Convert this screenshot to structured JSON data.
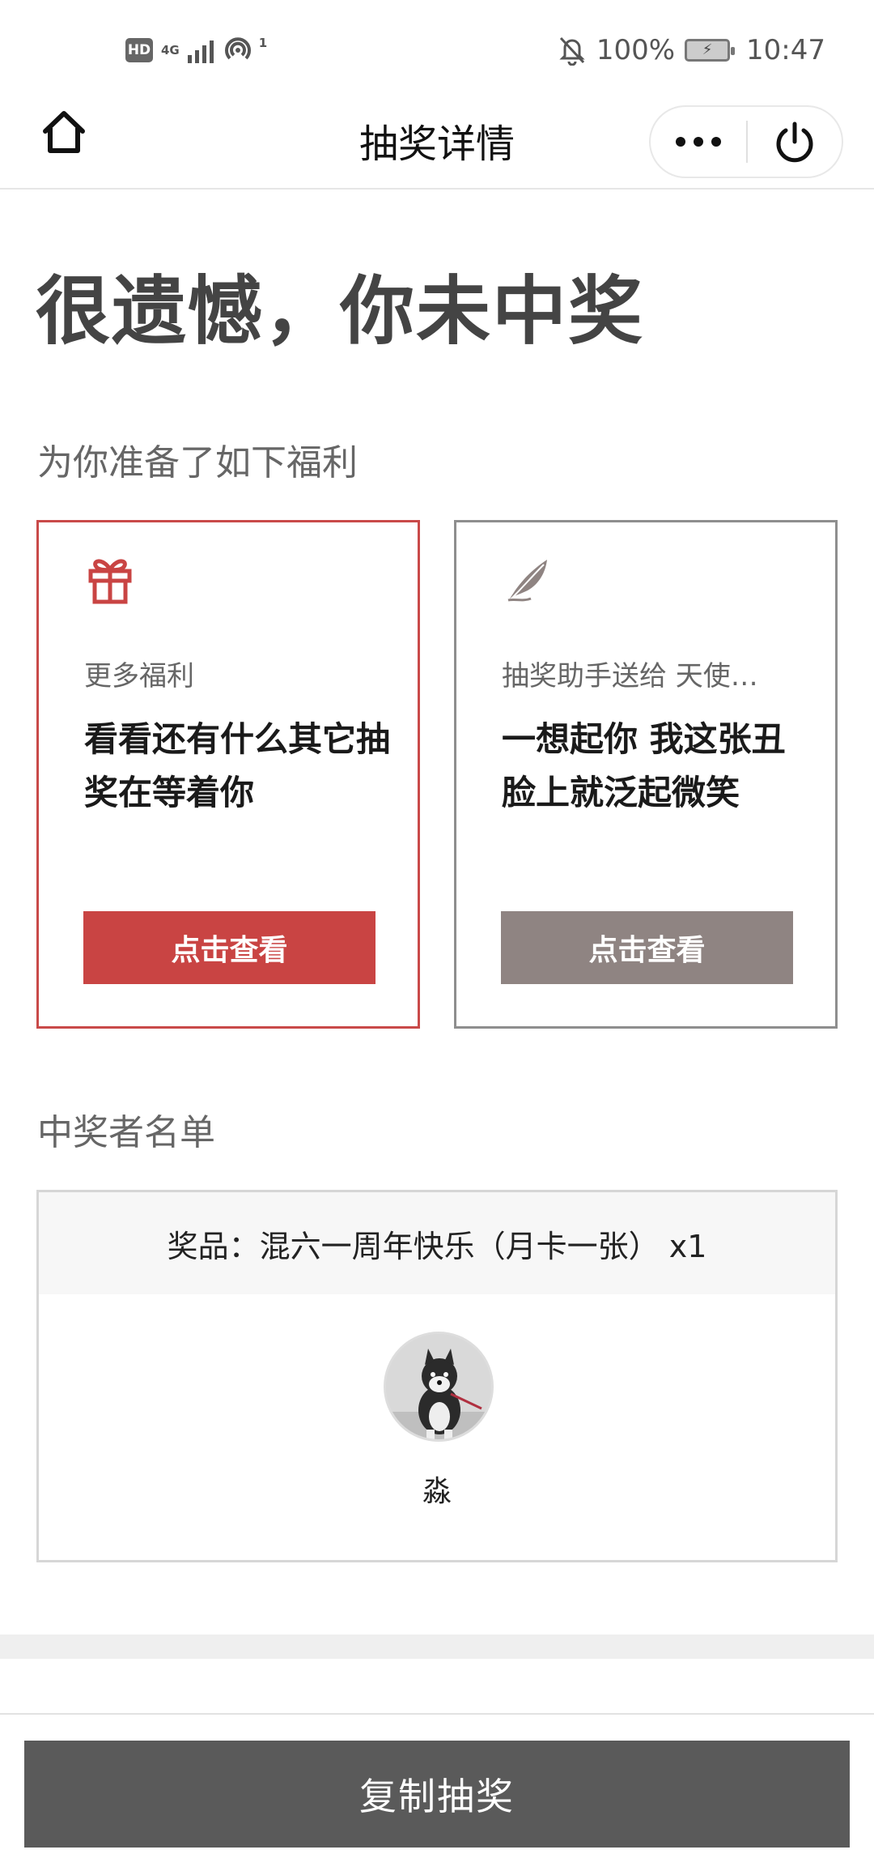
{
  "status_bar": {
    "hd": "HD",
    "network": "4G",
    "hotspot_count": "1",
    "battery_percent": "100%",
    "time": "10:47"
  },
  "nav": {
    "title": "抽奖详情"
  },
  "headline": "很遗憾，你未中奖",
  "welfare": {
    "label": "为你准备了如下福利",
    "cards": [
      {
        "icon": "gift-icon",
        "subtitle": "更多福利",
        "text": "看看还有什么其它抽奖在等着你",
        "button": "点击查看",
        "accent": "#c94443"
      },
      {
        "icon": "feather-icon",
        "subtitle": "抽奖助手送给 天使…",
        "text": "一想起你 我这张丑脸上就泛起微笑",
        "button": "点击查看",
        "accent": "#8f8482"
      }
    ]
  },
  "winners": {
    "label": "中奖者名单",
    "prize": "奖品：混六一周年快乐（月卡一张） x1",
    "winner_name": "淼"
  },
  "bottom": {
    "copy_button": "复制抽奖"
  }
}
